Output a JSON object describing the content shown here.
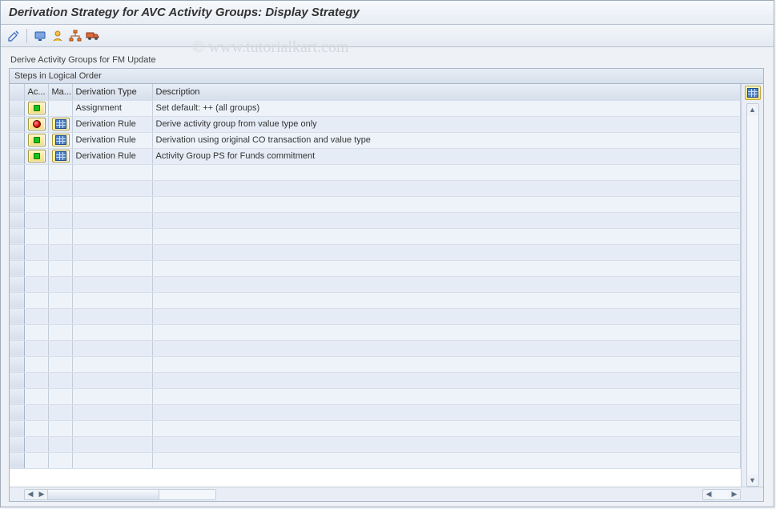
{
  "window": {
    "title": "Derivation Strategy for AVC Activity Groups: Display Strategy"
  },
  "watermark": "© www.tutorialkart.com",
  "toolbar": {
    "icons": [
      "edit-icon",
      "display-icon",
      "user-icon",
      "hierarchy-icon",
      "transport-icon"
    ]
  },
  "caption": "Derive Activity Groups for FM Update",
  "grid": {
    "title": "Steps in Logical Order",
    "columns": {
      "ac": "Ac...",
      "ma": "Ma...",
      "type": "Derivation Type",
      "desc": "Description"
    },
    "config_btn": "configure-columns",
    "rows": [
      {
        "status": "green",
        "maint": "",
        "type": "Assignment",
        "desc": "Set default: ++ (all groups)"
      },
      {
        "status": "red",
        "maint": "matrix",
        "type": "Derivation Rule",
        "desc": "Derive activity group from value type only"
      },
      {
        "status": "green",
        "maint": "matrix",
        "type": "Derivation Rule",
        "desc": "Derivation using original CO transaction and value type"
      },
      {
        "status": "green",
        "maint": "matrix",
        "type": "Derivation Rule",
        "desc": "Activity Group PS for Funds commitment"
      }
    ],
    "empty_rows": 19
  }
}
